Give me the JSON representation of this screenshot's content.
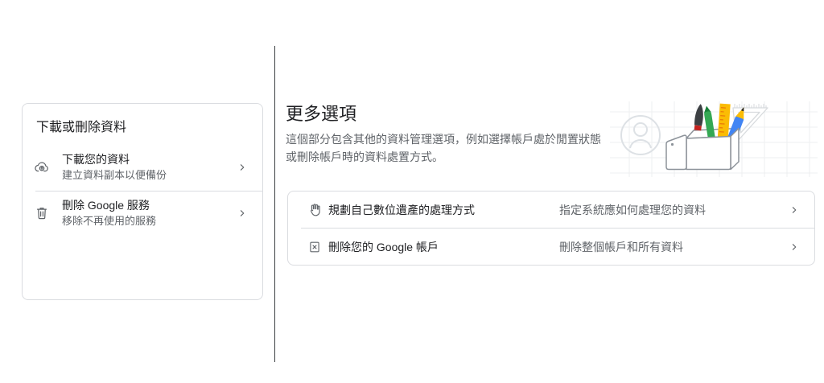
{
  "colors": {
    "card_border": "#dadce0",
    "section_divider": "#3c4043",
    "title_text": "#202124",
    "secondary_text": "#5f6368",
    "icon_gray": "#5f6368",
    "illustration_blue": "#4285f4",
    "illustration_green": "#34a853",
    "illustration_yellow": "#fbbc04",
    "illustration_red": "#c5221f"
  },
  "left_card": {
    "title": "下載或刪除資料",
    "items": [
      {
        "icon": "cloud-download-icon",
        "title": "下載您的資料",
        "subtitle": "建立資料副本以便備份",
        "trailing_icon": "chevron-right-icon"
      },
      {
        "icon": "trash-icon",
        "title": "刪除 Google 服務",
        "subtitle": "移除不再使用的服務",
        "trailing_icon": "chevron-right-icon"
      }
    ]
  },
  "more_options": {
    "heading": "更多選項",
    "description_line1": "這個部分包含其他的資料管理選項，例如選擇帳戶處於閒置狀態",
    "description_line2": "或刪除帳戶時的資料處置方式。",
    "illustration": "toolbox-with-stationery-illustration",
    "items": [
      {
        "icon": "hand-icon",
        "title": "規劃自己數位遺產的處理方式",
        "secondary": "指定系統應如何處理您的資料",
        "trailing_icon": "chevron-right-icon"
      },
      {
        "icon": "delete-account-icon",
        "title": "刪除您的 Google 帳戶",
        "secondary": "刪除整個帳戶和所有資料",
        "trailing_icon": "chevron-right-icon"
      }
    ]
  }
}
